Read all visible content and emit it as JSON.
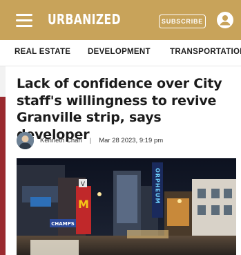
{
  "header": {
    "logo": "URBANIZED",
    "subscribe_label": "SUBSCRIBE",
    "brand_color": "#c8a35a"
  },
  "nav": {
    "items": [
      {
        "label": "REAL ESTATE"
      },
      {
        "label": "DEVELOPMENT"
      },
      {
        "label": "TRANSPORTATION"
      }
    ]
  },
  "article": {
    "headline": "Lack of confidence over City staff's willingness to revive Granville strip, says developer",
    "author": "Kenneth Chan",
    "separator": "|",
    "date": "Mar 28 2023, 9:19 pm",
    "photo_signs": {
      "mcdonalds": "M",
      "orpheum": "ORPHEUM",
      "champs": "CHAMPS",
      "v": "V"
    }
  },
  "colors": {
    "accent_strip": "#9a2a2f",
    "headline_text": "#1b1b1b"
  },
  "icons": [
    "hamburger-menu-icon",
    "account-icon"
  ]
}
